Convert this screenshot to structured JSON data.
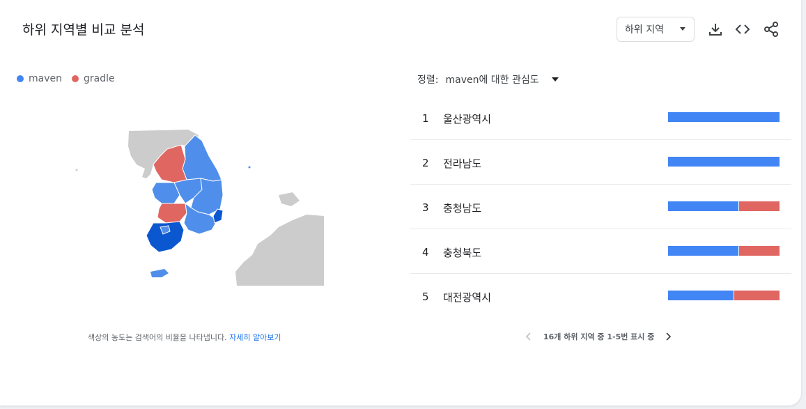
{
  "title": "하위 지역별 비교 분석",
  "region_dropdown": {
    "value": "하위 지역"
  },
  "toolbar": {
    "download_icon": "download-icon",
    "embed_icon": "code-icon",
    "share_icon": "share-icon"
  },
  "legend": [
    {
      "label": "maven",
      "color": "#4285f4"
    },
    {
      "label": "gradle",
      "color": "#e06662"
    }
  ],
  "map_note": {
    "text": "색상의 농도는 검색어의 비율을 나타냅니다.",
    "link": "자세히 알아보기"
  },
  "sort": {
    "label": "정렬:",
    "value": "maven에 대한 관심도"
  },
  "rows": [
    {
      "rank": "1",
      "name": "울산광역시",
      "share_maven": 100,
      "share_gradle": 0
    },
    {
      "rank": "2",
      "name": "전라남도",
      "share_maven": 100,
      "share_gradle": 0
    },
    {
      "rank": "3",
      "name": "충청남도",
      "share_maven": 63,
      "share_gradle": 37
    },
    {
      "rank": "4",
      "name": "충청북도",
      "share_maven": 63,
      "share_gradle": 37
    },
    {
      "rank": "5",
      "name": "대전광역시",
      "share_maven": 59,
      "share_gradle": 41
    }
  ],
  "pager": {
    "text": "16개 하위 지역 중 1-5번 표시 중"
  }
}
